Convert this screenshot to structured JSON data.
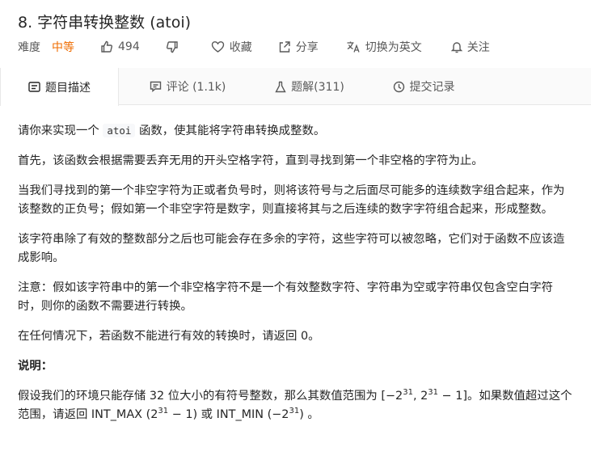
{
  "problem": {
    "title": "8. 字符串转换整数 (atoi)",
    "difficulty_label": "难度",
    "difficulty": "中等",
    "likes": "494",
    "favorite_label": "收藏",
    "share_label": "分享",
    "switch_lang_label": "切换为英文",
    "follow_label": "关注"
  },
  "tabs": [
    {
      "label": "题目描述",
      "icon": "description-icon"
    },
    {
      "label": "评论 (1.1k)",
      "icon": "comment-icon"
    },
    {
      "label": "题解(311)",
      "icon": "flask-icon"
    },
    {
      "label": "提交记录",
      "icon": "clock-icon"
    }
  ],
  "content": {
    "p1_a": "请你来实现一个 ",
    "p1_code": "atoi",
    "p1_b": " 函数，使其能将字符串转换成整数。",
    "p2": "首先，该函数会根据需要丢弃无用的开头空格字符，直到寻找到第一个非空格的字符为止。",
    "p3": "当我们寻找到的第一个非空字符为正或者负号时，则将该符号与之后面尽可能多的连续数字组合起来，作为该整数的正负号；假如第一个非空字符是数字，则直接将其与之后连续的数字字符组合起来，形成整数。",
    "p4": "该字符串除了有效的整数部分之后也可能会存在多余的字符，这些字符可以被忽略，它们对于函数不应该造成影响。",
    "p5": "注意：假如该字符串中的第一个非空格字符不是一个有效整数字符、字符串为空或字符串仅包含空白字符时，则你的函数不需要进行转换。",
    "p6": "在任何情况下，若函数不能进行有效的转换时，请返回 0。",
    "note_heading": "说明：",
    "p7_a": "假设我们的环境只能存储 32 位大小的有符号整数，那么其数值范围为 [−2",
    "p7_sup1": "31",
    "p7_b": ",  2",
    "p7_sup2": "31",
    "p7_c": " − 1]。如果数值超过这个范围，请返回  INT_MAX (2",
    "p7_sup3": "31",
    "p7_d": " − 1) 或 INT_MIN (−2",
    "p7_sup4": "31",
    "p7_e": ") 。"
  },
  "colors": {
    "difficulty": "#ef6c00",
    "text": "#262626",
    "muted": "#595959",
    "tab_bar": "#fafafa"
  }
}
